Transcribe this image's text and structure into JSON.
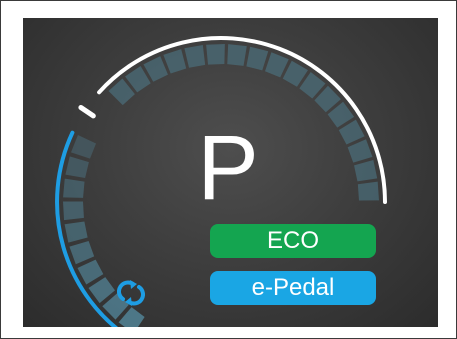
{
  "display": {
    "gear": "P",
    "drive_mode": "ECO",
    "pedal_mode": "e-Pedal"
  },
  "gauges": {
    "power_level": 0.0,
    "charge_level": 0.45
  },
  "colors": {
    "screen_background": "#3e3e3e",
    "eco_green": "#14a550",
    "pedal_blue": "#1aa6e4",
    "charge_arc_blue": "#1e9de3",
    "segment_blue": "#4f7b8c",
    "arc_white": "#ffffff"
  },
  "icons": {
    "regen": "regeneration-arrows-icon"
  }
}
